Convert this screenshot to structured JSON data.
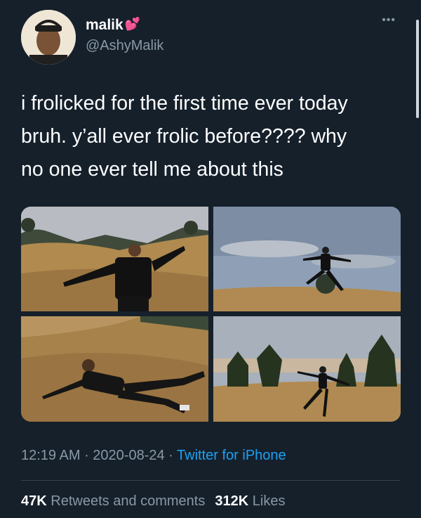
{
  "user": {
    "name": "malik",
    "handle": "@AshyMalik",
    "badge": "heart-emoji"
  },
  "more_label": "•••",
  "tweet": {
    "text": "i frolicked for the first time ever today\nbruh. y’all ever frolic before???? why\nno one ever tell me about this"
  },
  "meta": {
    "time": "12:19 AM",
    "sep1": " · ",
    "date": "2020-08-24",
    "sep2": " · ",
    "source": "Twitter for iPhone"
  },
  "stats": {
    "retweets_count": "47K",
    "retweets_label": "Retweets and comments",
    "likes_count": "312K",
    "likes_label": "Likes"
  },
  "colors": {
    "background": "#15202b",
    "text_secondary": "#8899a6",
    "link": "#1da1f2",
    "divider": "#38444d"
  }
}
